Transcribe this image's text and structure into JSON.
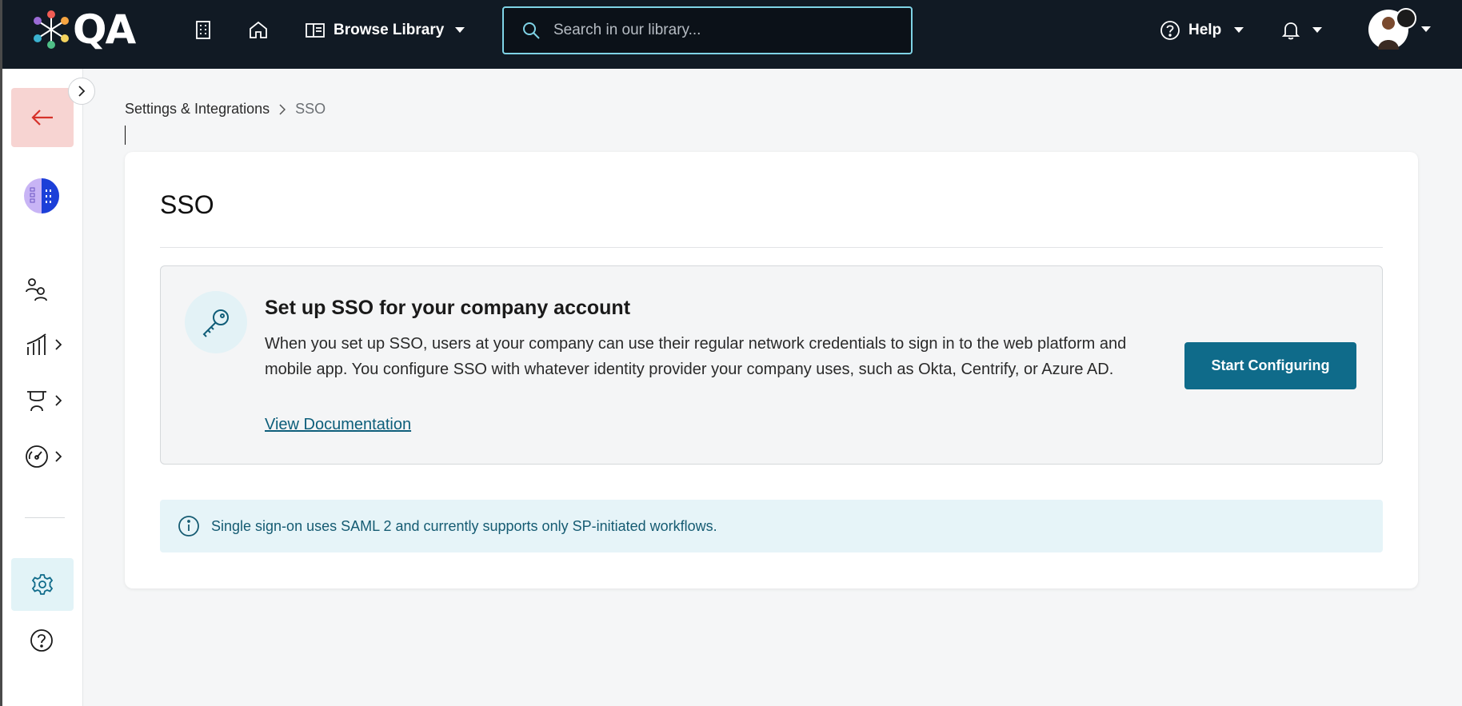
{
  "app": {
    "logo_text": "QA"
  },
  "header": {
    "nav_icons": [
      "building-icon",
      "home-icon"
    ],
    "browse_label": "Browse Library",
    "search_placeholder": "Search in our library...",
    "help_label": "Help"
  },
  "sidebar": {
    "items": [
      "people-icon",
      "analytics-icon",
      "learning-icon",
      "dashboard-icon",
      "settings-icon",
      "help-icon"
    ]
  },
  "breadcrumb": {
    "parent": "Settings & Integrations",
    "current": "SSO"
  },
  "card": {
    "title": "SSO",
    "setup_heading": "Set up SSO for your company account",
    "setup_description": "When you set up SSO, users at your company can use their regular network credentials to sign in to the web platform and mobile app. You configure SSO with whatever identity provider your company uses, such as Okta, Centrify, or Azure AD.",
    "doc_link": "View Documentation",
    "start_button": "Start Configuring",
    "info_text": "Single sign-on uses SAML 2 and currently supports only SP-initiated workflows."
  },
  "colors": {
    "topbar": "#111a24",
    "primary": "#0f6b8a",
    "back_button_bg": "#f7d4d2",
    "info_bg": "#e6f4f8"
  }
}
